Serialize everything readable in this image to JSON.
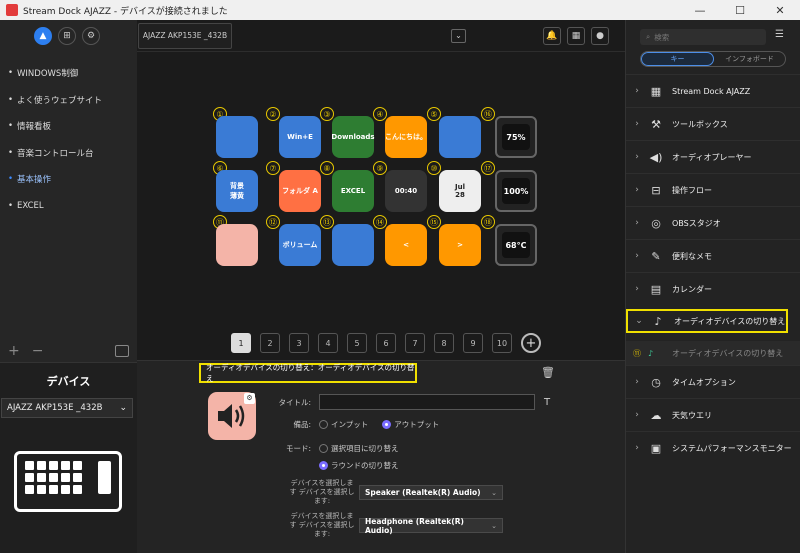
{
  "window": {
    "title": "Stream Dock AJAZZ - デバイスが接続されました",
    "minimize": "—",
    "maximize": "☐",
    "close": "✕"
  },
  "sidebar": {
    "items": [
      {
        "label": "WINDOWS制御",
        "selected": false
      },
      {
        "label": "よく使うウェブサイト",
        "selected": false
      },
      {
        "label": "情報看板",
        "selected": false
      },
      {
        "label": "音楽コントロール台",
        "selected": false
      },
      {
        "label": "基本操作",
        "selected": true
      },
      {
        "label": "EXCEL",
        "selected": false
      }
    ],
    "add": "+",
    "remove": "−"
  },
  "device_panel": {
    "title": "デバイス",
    "selected_device": "AJAZZ AKP153E _432B"
  },
  "topbar": {
    "device_tab": "AJAZZ AKP153E _432B"
  },
  "keys": [
    {
      "num": "①",
      "label": "",
      "bg": "#3a7bd5"
    },
    {
      "num": "②",
      "label": "Win+E",
      "bg": "#3a7bd5"
    },
    {
      "num": "③",
      "label": "Downloads",
      "bg": "#2e7d32"
    },
    {
      "num": "④",
      "label": "こんにちは。",
      "bg": "#ff9800"
    },
    {
      "num": "⑤",
      "label": "",
      "bg": "#3a7bd5"
    },
    {
      "num": "⑥",
      "label": "背景\n薄黄",
      "bg": "#3a7bd5"
    },
    {
      "num": "⑦",
      "label": "フォルダ A",
      "bg": "#ff7043"
    },
    {
      "num": "⑧",
      "label": "EXCEL",
      "bg": "#2e7d32"
    },
    {
      "num": "⑨",
      "label": "00:40",
      "bg": "#333333"
    },
    {
      "num": "⑩",
      "label": "Jul\n28",
      "bg": "#eeeeee"
    },
    {
      "num": "⑪",
      "label": "",
      "bg": "#f4b4a8"
    },
    {
      "num": "⑫",
      "label": "ボリューム",
      "bg": "#3a7bd5"
    },
    {
      "num": "⑬",
      "label": "",
      "bg": "#3a7bd5"
    },
    {
      "num": "⑭",
      "label": "<",
      "bg": "#ff9800"
    },
    {
      "num": "⑮",
      "label": ">",
      "bg": "#ff9800"
    }
  ],
  "knobs": [
    {
      "num": "⑯",
      "label": "75%"
    },
    {
      "num": "⑰",
      "label": "100%"
    },
    {
      "num": "⑱",
      "label": "68°C"
    }
  ],
  "pages": [
    "1",
    "2",
    "3",
    "4",
    "5",
    "6",
    "7",
    "8",
    "9",
    "10"
  ],
  "page_add": "+",
  "props": {
    "header": "オーディオデバイスの切り替え：オーディオデバイスの切り替え",
    "title_label": "タイトル:",
    "title_value": "",
    "title_btn": "T",
    "equipment_label": "備品:",
    "equipment_options": [
      "インプット",
      "アウトプット"
    ],
    "mode_label": "モード:",
    "mode_options": [
      "選択項目に切り替え",
      "ラウンドの切り替え"
    ],
    "device1_label": "デバイスを選択します デバイスを選択し ます:",
    "device1_value": "Speaker (Realtek(R) Audio)",
    "device2_label": "デバイスを選択します デバイスを選択し ます:",
    "device2_value": "Headphone (Realtek(R) Audio)"
  },
  "right_panel": {
    "search_placeholder": "検索",
    "tabs": [
      "キー",
      "インフォボード"
    ],
    "categories": [
      {
        "label": "Stream Dock AJAZZ",
        "icon": "▦"
      },
      {
        "label": "ツールボックス",
        "icon": "⚒"
      },
      {
        "label": "オーディオプレーヤー",
        "icon": "◀)"
      },
      {
        "label": "操作フロー",
        "icon": "⊟"
      },
      {
        "label": "OBSスタジオ",
        "icon": "◎"
      },
      {
        "label": "便利なメモ",
        "icon": "✎"
      },
      {
        "label": "カレンダー",
        "icon": "▤"
      },
      {
        "label": "オーディオデバイスの切り替え",
        "icon": "♪",
        "expanded": true
      },
      {
        "label": "タイムオプション",
        "icon": "◷"
      },
      {
        "label": "天気ウエリ",
        "icon": "☁"
      },
      {
        "label": "システムパフォーマンスモニター",
        "icon": "▣"
      }
    ],
    "sub_item": {
      "num": "⑪",
      "label": "オーディオデバイスの切り替え"
    }
  }
}
